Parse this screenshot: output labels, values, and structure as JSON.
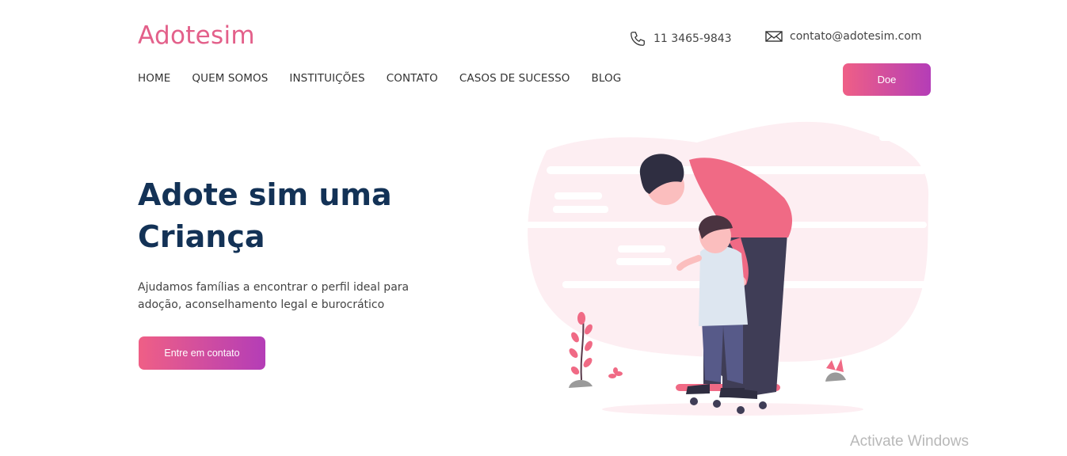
{
  "brand": {
    "name": "Adotesim"
  },
  "contacts": {
    "phone": {
      "icon": "phone-icon",
      "text": "11 3465-9843"
    },
    "email": {
      "icon": "mail-icon",
      "text": "contato@adotesim.com"
    }
  },
  "nav": {
    "items": [
      {
        "label": "HOME"
      },
      {
        "label": "QUEM SOMOS"
      },
      {
        "label": "INSTITUIÇÕES"
      },
      {
        "label": "CONTATO"
      },
      {
        "label": "CASOS DE SUCESSO"
      },
      {
        "label": "BLOG"
      }
    ],
    "donate_label": "Doe"
  },
  "hero": {
    "title_line1": "Adote sim uma",
    "title_line2": "Criança",
    "subtitle_line1": "Ajudamos famílias a encontrar o perfil ideal para",
    "subtitle_line2": "adoção, aconselhamento legal e burocrático",
    "cta_label": "Entre em contato"
  },
  "colors": {
    "brand_pink": "#e3608a",
    "gradient_start": "#ef5f86",
    "gradient_end": "#b43db7",
    "title_navy": "#133256"
  },
  "os_overlay": {
    "watermark": "Activate Windows"
  }
}
